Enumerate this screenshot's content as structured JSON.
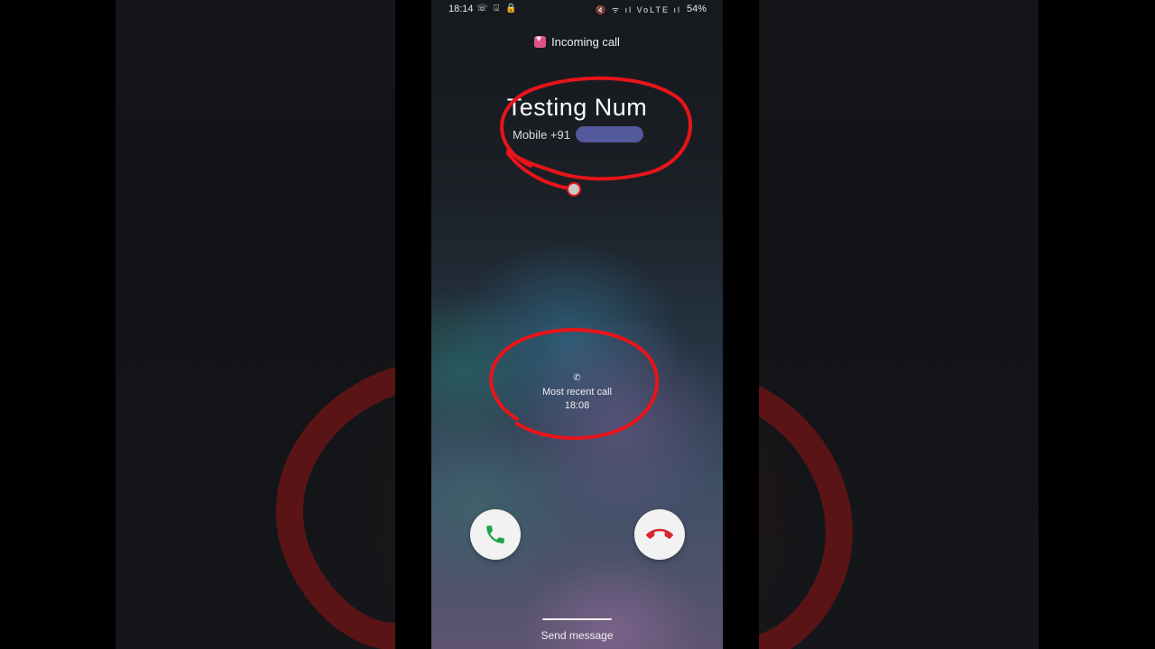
{
  "status_bar": {
    "time": "18:14",
    "left_icons": "☏ ⌻ 🔒",
    "right_icons": "🔇 ᯤ ıl VoLTE ıl",
    "battery": "54%"
  },
  "header": {
    "incoming_label": "Incoming call"
  },
  "caller": {
    "name": "Testing Num",
    "number_visible": "Mobile  +91"
  },
  "recent_call": {
    "label": "Most recent call",
    "time": "18:08"
  },
  "actions": {
    "accept_icon": "phone-icon",
    "decline_icon": "phone-hangup-icon",
    "send_message": "Send message"
  },
  "colors": {
    "accept": "#1ea34a",
    "decline": "#d8262d",
    "annotation": "#e8141a"
  }
}
